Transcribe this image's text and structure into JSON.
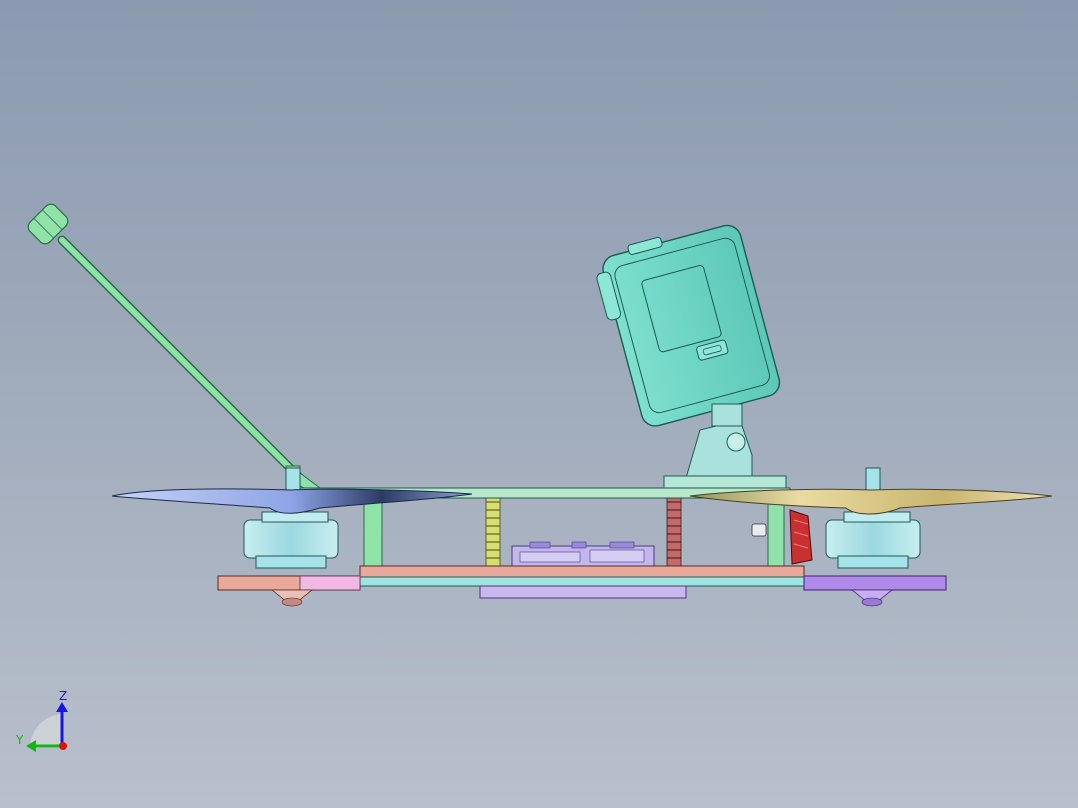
{
  "triad": {
    "z_label": "Z",
    "y_label": "Y",
    "colors": {
      "z": "#1515ee",
      "y": "#13b513",
      "origin": "#e01010"
    }
  },
  "colors": {
    "background_top": "#8b9ab0",
    "background_bottom": "#b9c0cc",
    "camera": "#6fd8c6",
    "antenna": "#8fe3a8",
    "top_plate": "#b8e8cc",
    "bottom_plate_left": "#e8a89a",
    "bottom_plate_right": "#b08ae8",
    "prop_left": "#9db2ea",
    "prop_right": "#e6d79e",
    "motor": "#a6e3e8",
    "standoff_yellow": "#d8dd70",
    "standoff_red": "#c46a6a",
    "pcb": "#c3b5ee",
    "esc_red": "#c93030"
  }
}
